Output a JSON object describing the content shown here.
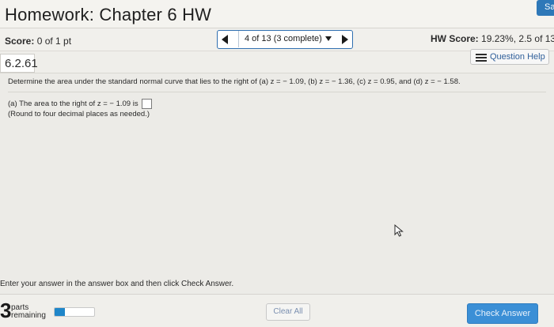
{
  "header": {
    "title": "Homework: Chapter 6 HW",
    "save_label": "Sa"
  },
  "score": {
    "label": "Score:",
    "value": "0 of 1 pt"
  },
  "navigation": {
    "position_text": "4 of 13 (3 complete)"
  },
  "hw_score": {
    "label": "HW Score:",
    "value": "19.23%, 2.5 of 13"
  },
  "question": {
    "number": "6.2.61",
    "help_label": "Question Help",
    "stem": "Determine the area under the standard normal curve that lies to the right of (a) z = − 1.09, (b) z = − 1.36, (c) z = 0.95, and (d) z = − 1.58.",
    "part_a": "(a) The area to the right of z = − 1.09 is",
    "round_note": "(Round to four decimal places as needed.)",
    "answer_value": ""
  },
  "footer": {
    "instruction": "Enter your answer in the answer box and then click Check Answer.",
    "parts_count": "3",
    "parts_label_1": "parts",
    "parts_label_2": "remaining",
    "progress_fraction": 0.25,
    "clear_label": "Clear All",
    "check_label": "Check Answer"
  },
  "colors": {
    "accent": "#2f6fb0",
    "check_button": "#3b8fd6",
    "progress": "#1f86c9"
  }
}
